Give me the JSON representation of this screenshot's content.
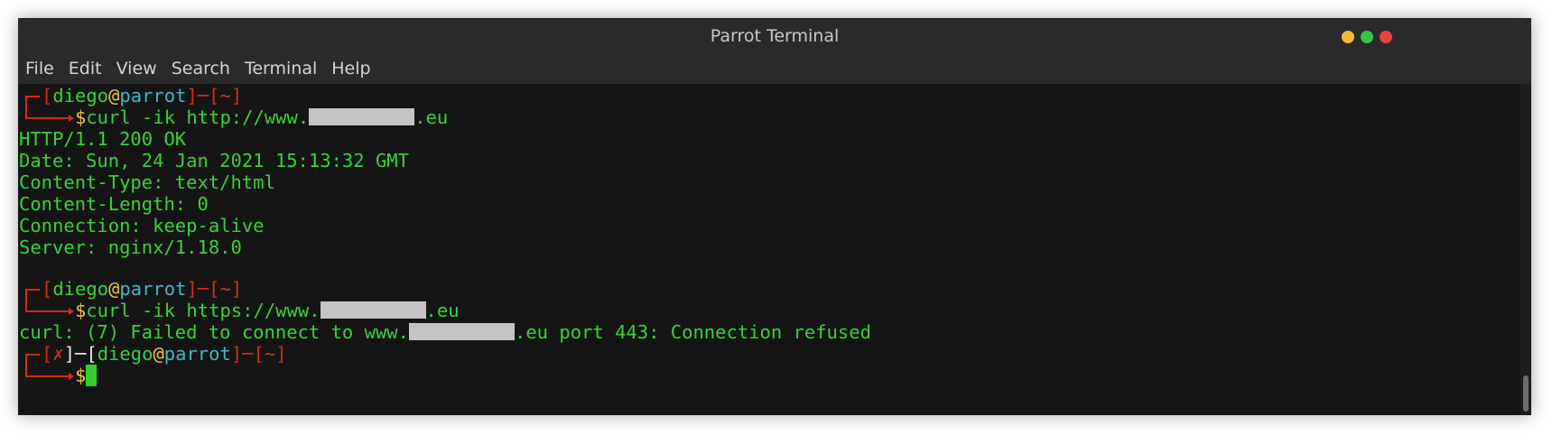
{
  "window": {
    "title": "Parrot Terminal",
    "buttons": [
      {
        "name": "minimize",
        "color": "#f5b83d"
      },
      {
        "name": "maximize",
        "color": "#33c748"
      },
      {
        "name": "close",
        "color": "#e8443a"
      }
    ]
  },
  "menu": [
    "File",
    "Edit",
    "View",
    "Search",
    "Terminal",
    "Help"
  ],
  "colors": {
    "terminal_bg": "#151515",
    "text_green": "#36d436",
    "prompt_red": "#d62a1e",
    "host_cyan": "#3fb8c7",
    "at_yellow": "#f2c436"
  },
  "prompt": {
    "user": "diego",
    "at": "@",
    "host": "parrot",
    "dir": "~",
    "symbol": "$",
    "fail_mark": "✗"
  },
  "terminal": {
    "cmd1_prefix": "curl -ik http://www.",
    "cmd1_suffix": ".eu",
    "output1": [
      "HTTP/1.1 200 OK",
      "Date: Sun, 24 Jan 2021 15:13:32 GMT",
      "Content-Type: text/html",
      "Content-Length: 0",
      "Connection: keep-alive",
      "Server: nginx/1.18.0"
    ],
    "cmd2_prefix": "curl -ik https://www.",
    "cmd2_suffix": ".eu",
    "error_prefix": "curl: (7) Failed to connect to www.",
    "error_suffix": ".eu port 443: Connection refused"
  }
}
